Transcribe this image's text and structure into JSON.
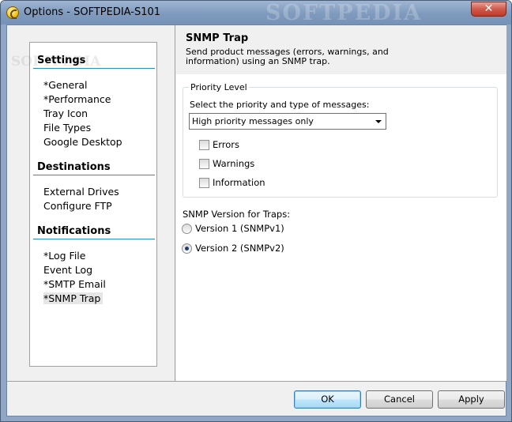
{
  "window": {
    "title": "Options - SOFTPEDIA-S101",
    "watermark": "SOFTPEDIA",
    "close_glyph": "✕"
  },
  "sidebar": {
    "watermark": "SOFTPEDIA",
    "sections": [
      {
        "label": "Settings",
        "items": [
          "*General",
          "*Performance",
          "Tray Icon",
          "File Types",
          "Google Desktop"
        ]
      },
      {
        "label": "Destinations",
        "items": [
          "External Drives",
          "Configure FTP"
        ]
      },
      {
        "label": "Notifications",
        "items": [
          "*Log File",
          "Event Log",
          "*SMTP Email",
          "*SNMP Trap"
        ]
      }
    ],
    "selected_item": "*SNMP Trap"
  },
  "content": {
    "title": "SNMP Trap",
    "description": "Send product messages (errors, warnings, and information) using an SNMP trap.",
    "priority_group": {
      "legend": "Priority Level",
      "label": "Select the priority and type of messages:",
      "selected_option": "High priority messages only",
      "checkboxes": [
        {
          "label": "Errors",
          "checked": false
        },
        {
          "label": "Warnings",
          "checked": false
        },
        {
          "label": "Information",
          "checked": false
        }
      ]
    },
    "snmp_version": {
      "label": "SNMP Version for Traps:",
      "options": [
        {
          "label": "Version 1 (SNMPv1)",
          "checked": false
        },
        {
          "label": "Version 2 (SNMPv2)",
          "checked": true
        }
      ]
    }
  },
  "footer": {
    "ok_label": "OK",
    "cancel_label": "Cancel",
    "apply_label": "Apply"
  }
}
